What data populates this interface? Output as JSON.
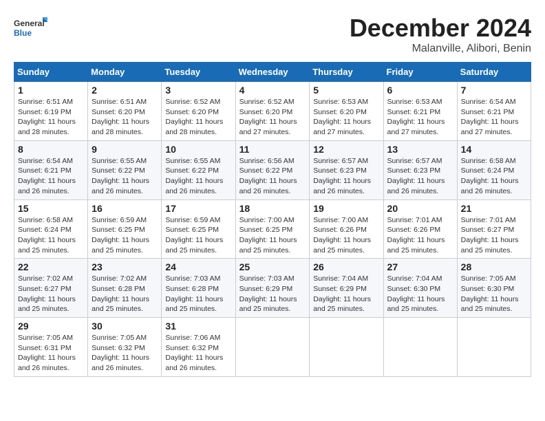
{
  "logo": {
    "text_general": "General",
    "text_blue": "Blue"
  },
  "title": "December 2024",
  "location": "Malanville, Alibori, Benin",
  "days_of_week": [
    "Sunday",
    "Monday",
    "Tuesday",
    "Wednesday",
    "Thursday",
    "Friday",
    "Saturday"
  ],
  "weeks": [
    [
      {
        "day": 1,
        "sunrise": "6:51 AM",
        "sunset": "6:19 PM",
        "daylight": "11 hours and 28 minutes."
      },
      {
        "day": 2,
        "sunrise": "6:51 AM",
        "sunset": "6:20 PM",
        "daylight": "11 hours and 28 minutes."
      },
      {
        "day": 3,
        "sunrise": "6:52 AM",
        "sunset": "6:20 PM",
        "daylight": "11 hours and 28 minutes."
      },
      {
        "day": 4,
        "sunrise": "6:52 AM",
        "sunset": "6:20 PM",
        "daylight": "11 hours and 27 minutes."
      },
      {
        "day": 5,
        "sunrise": "6:53 AM",
        "sunset": "6:20 PM",
        "daylight": "11 hours and 27 minutes."
      },
      {
        "day": 6,
        "sunrise": "6:53 AM",
        "sunset": "6:21 PM",
        "daylight": "11 hours and 27 minutes."
      },
      {
        "day": 7,
        "sunrise": "6:54 AM",
        "sunset": "6:21 PM",
        "daylight": "11 hours and 27 minutes."
      }
    ],
    [
      {
        "day": 8,
        "sunrise": "6:54 AM",
        "sunset": "6:21 PM",
        "daylight": "11 hours and 26 minutes."
      },
      {
        "day": 9,
        "sunrise": "6:55 AM",
        "sunset": "6:22 PM",
        "daylight": "11 hours and 26 minutes."
      },
      {
        "day": 10,
        "sunrise": "6:55 AM",
        "sunset": "6:22 PM",
        "daylight": "11 hours and 26 minutes."
      },
      {
        "day": 11,
        "sunrise": "6:56 AM",
        "sunset": "6:22 PM",
        "daylight": "11 hours and 26 minutes."
      },
      {
        "day": 12,
        "sunrise": "6:57 AM",
        "sunset": "6:23 PM",
        "daylight": "11 hours and 26 minutes."
      },
      {
        "day": 13,
        "sunrise": "6:57 AM",
        "sunset": "6:23 PM",
        "daylight": "11 hours and 26 minutes."
      },
      {
        "day": 14,
        "sunrise": "6:58 AM",
        "sunset": "6:24 PM",
        "daylight": "11 hours and 26 minutes."
      }
    ],
    [
      {
        "day": 15,
        "sunrise": "6:58 AM",
        "sunset": "6:24 PM",
        "daylight": "11 hours and 25 minutes."
      },
      {
        "day": 16,
        "sunrise": "6:59 AM",
        "sunset": "6:25 PM",
        "daylight": "11 hours and 25 minutes."
      },
      {
        "day": 17,
        "sunrise": "6:59 AM",
        "sunset": "6:25 PM",
        "daylight": "11 hours and 25 minutes."
      },
      {
        "day": 18,
        "sunrise": "7:00 AM",
        "sunset": "6:25 PM",
        "daylight": "11 hours and 25 minutes."
      },
      {
        "day": 19,
        "sunrise": "7:00 AM",
        "sunset": "6:26 PM",
        "daylight": "11 hours and 25 minutes."
      },
      {
        "day": 20,
        "sunrise": "7:01 AM",
        "sunset": "6:26 PM",
        "daylight": "11 hours and 25 minutes."
      },
      {
        "day": 21,
        "sunrise": "7:01 AM",
        "sunset": "6:27 PM",
        "daylight": "11 hours and 25 minutes."
      }
    ],
    [
      {
        "day": 22,
        "sunrise": "7:02 AM",
        "sunset": "6:27 PM",
        "daylight": "11 hours and 25 minutes."
      },
      {
        "day": 23,
        "sunrise": "7:02 AM",
        "sunset": "6:28 PM",
        "daylight": "11 hours and 25 minutes."
      },
      {
        "day": 24,
        "sunrise": "7:03 AM",
        "sunset": "6:28 PM",
        "daylight": "11 hours and 25 minutes."
      },
      {
        "day": 25,
        "sunrise": "7:03 AM",
        "sunset": "6:29 PM",
        "daylight": "11 hours and 25 minutes."
      },
      {
        "day": 26,
        "sunrise": "7:04 AM",
        "sunset": "6:29 PM",
        "daylight": "11 hours and 25 minutes."
      },
      {
        "day": 27,
        "sunrise": "7:04 AM",
        "sunset": "6:30 PM",
        "daylight": "11 hours and 25 minutes."
      },
      {
        "day": 28,
        "sunrise": "7:05 AM",
        "sunset": "6:30 PM",
        "daylight": "11 hours and 25 minutes."
      }
    ],
    [
      {
        "day": 29,
        "sunrise": "7:05 AM",
        "sunset": "6:31 PM",
        "daylight": "11 hours and 26 minutes."
      },
      {
        "day": 30,
        "sunrise": "7:05 AM",
        "sunset": "6:32 PM",
        "daylight": "11 hours and 26 minutes."
      },
      {
        "day": 31,
        "sunrise": "7:06 AM",
        "sunset": "6:32 PM",
        "daylight": "11 hours and 26 minutes."
      },
      null,
      null,
      null,
      null
    ]
  ]
}
